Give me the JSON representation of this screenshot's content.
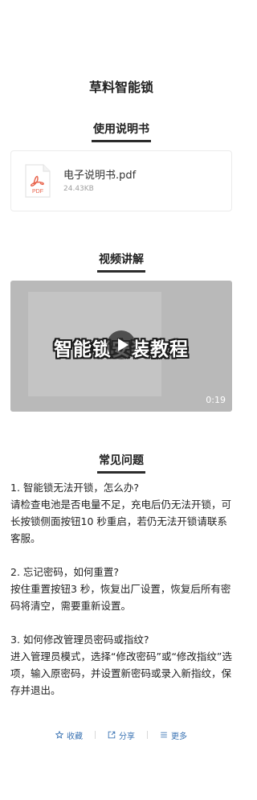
{
  "page": {
    "title": "草料智能锁"
  },
  "manual_section": {
    "heading": "使用说明书",
    "attachment": {
      "file_name": "电子说明书.pdf",
      "file_size": "24.43KB",
      "icon": "pdf-file-icon",
      "icon_label": "PDF",
      "accent_color": "#e8624a"
    }
  },
  "video_section": {
    "heading": "视频讲解",
    "video": {
      "caption": "智能锁安装教程",
      "duration": "0:19",
      "icon": "play-icon"
    }
  },
  "faq_section": {
    "heading": "常见问题",
    "items": [
      {
        "question": "1. 智能锁无法开锁，怎么办?",
        "answer": "请检查电池是否电量不足，充电后仍无法开锁，可长按锁侧面按钮10 秒重启，若仍无法开锁请联系客服。"
      },
      {
        "question": "2. 忘记密码，如何重置?",
        "answer": "按住重置按钮3 秒，恢复出厂设置，恢复后所有密码将清空，需要重新设置。"
      },
      {
        "question": "3. 如何修改管理员密码或指纹?",
        "answer": "进入管理员模式，选择“修改密码”或“修改指纹”选项，输入原密码，并设置新密码或录入新指纹，保存并退出。"
      }
    ]
  },
  "actions": {
    "favorite": {
      "label": "收藏",
      "icon": "star-icon"
    },
    "share": {
      "label": "分享",
      "icon": "share-icon"
    },
    "more": {
      "label": "更多",
      "icon": "menu-icon"
    },
    "color": "#3a73b3"
  }
}
